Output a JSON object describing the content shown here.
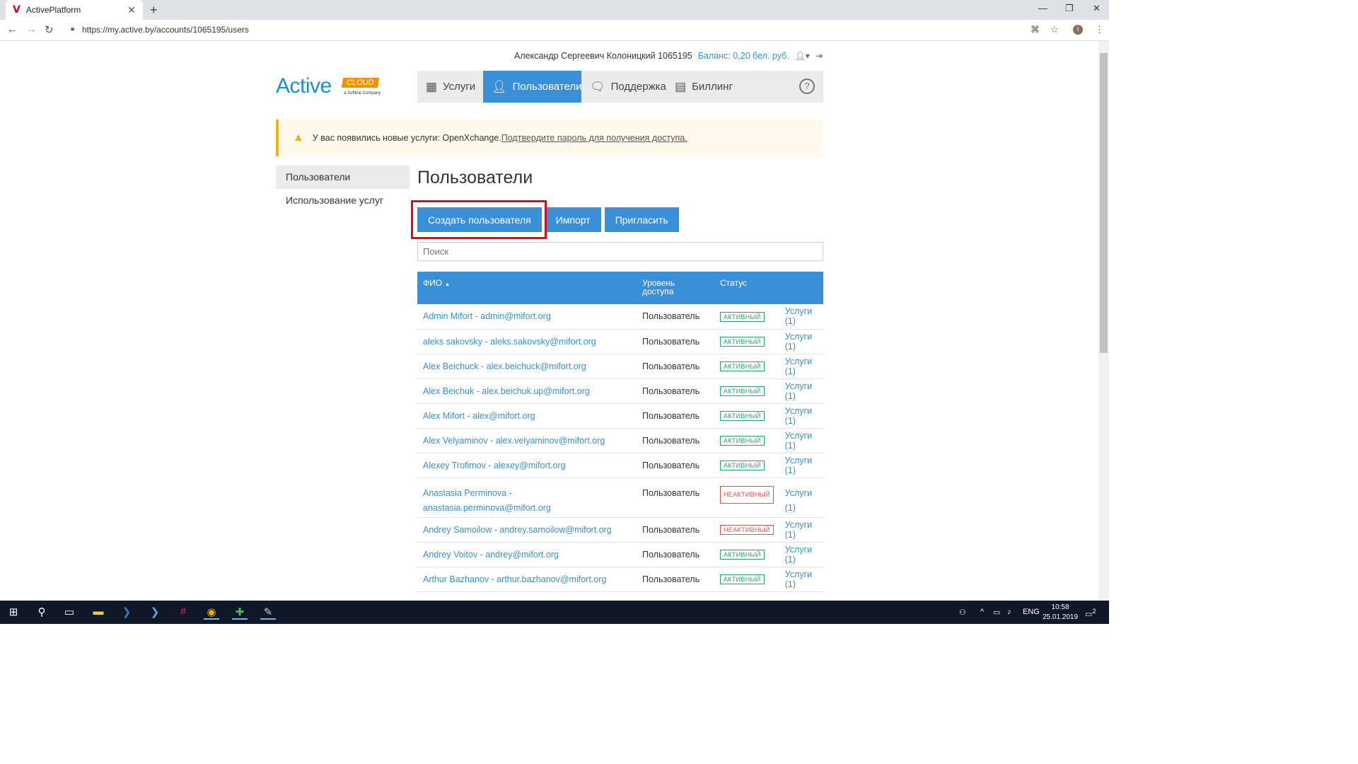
{
  "browser": {
    "tab_title": "ActivePlatform",
    "favicon": "V",
    "url": "https://my.active.by/accounts/1065195/users"
  },
  "header": {
    "user_name": "Александр Сергеевич Колоницкий 1065195",
    "balance": "Баланс: 0,20 бел. руб."
  },
  "logo": {
    "main": "Active",
    "badge": "CLOUD",
    "tagline": "a Softline Company"
  },
  "nav": [
    {
      "label": "Услуги",
      "icon": "building-icon"
    },
    {
      "label": "Пользователи",
      "icon": "user-icon",
      "active": true
    },
    {
      "label": "Поддержка",
      "icon": "chat-icon"
    },
    {
      "label": "Биллинг",
      "icon": "document-icon"
    }
  ],
  "alert": {
    "text": "У вас появились новые услуги: OpenXchange.",
    "link": "Подтвердите пароль для получения доступа."
  },
  "sidebar": [
    {
      "label": "Пользователи",
      "active": true
    },
    {
      "label": "Использование услуг"
    }
  ],
  "main": {
    "title": "Пользователи",
    "buttons": {
      "create": "Создать пользователя",
      "import": "Импорт",
      "invite": "Пригласить"
    },
    "search_placeholder": "Поиск"
  },
  "table": {
    "headers": {
      "name": "ФИО",
      "access": "Уровень доступа",
      "status": "Статус"
    },
    "rows": [
      {
        "name": "Admin Mifort - admin@mifort.org",
        "access": "Пользователь",
        "status": "АКТИВНЫЙ",
        "services": "Услуги (1)"
      },
      {
        "name": "aleks sakovsky - aleks.sakovsky@mifort.org",
        "access": "Пользователь",
        "status": "АКТИВНЫЙ",
        "services": "Услуги (1)"
      },
      {
        "name": "Alex Beichuck - alex.beichuck@mifort.org",
        "access": "Пользователь",
        "status": "АКТИВНЫЙ",
        "services": "Услуги (1)"
      },
      {
        "name": "Alex Beichuk - alex.beichuk.up@mifort.org",
        "access": "Пользователь",
        "status": "АКТИВНЫЙ",
        "services": "Услуги (1)"
      },
      {
        "name": "Alex Mifort - alex@mifort.org",
        "access": "Пользователь",
        "status": "АКТИВНЫЙ",
        "services": "Услуги (1)"
      },
      {
        "name": "Alex Velyaminov - alex.velyaminov@mifort.org",
        "access": "Пользователь",
        "status": "АКТИВНЫЙ",
        "services": "Услуги (1)"
      },
      {
        "name": "Alexey Trofimov - alexey@mifort.org",
        "access": "Пользователь",
        "status": "АКТИВНЫЙ",
        "services": "Услуги (1)"
      },
      {
        "name": "Anastasia Perminova - anastasia.perminova@mifort.org",
        "access": "Пользователь",
        "status": "НЕАКТИВНЫЙ",
        "services": "Услуги (1)"
      },
      {
        "name": "Andrey Samoilow - andrey.samoilow@mifort.org",
        "access": "Пользователь",
        "status": "НЕАКТИВНЫЙ",
        "services": "Услуги (1)"
      },
      {
        "name": "Andrey Voitov - andrey@mifort.org",
        "access": "Пользователь",
        "status": "АКТИВНЫЙ",
        "services": "Услуги (1)"
      },
      {
        "name": "Arthur Bazhanov - arthur.bazhanov@mifort.org",
        "access": "Пользователь",
        "status": "АКТИВНЫЙ",
        "services": "Услуги (1)"
      }
    ]
  },
  "taskbar": {
    "lang": "ENG",
    "time": "10:58",
    "date": "25.01.2019",
    "notifications": "2"
  },
  "colors": {
    "accent": "#3a8fd9",
    "link": "#3a8fc9",
    "active_badge": "#29a36a",
    "inactive_badge": "#d9534f",
    "highlight": "#d0101e"
  }
}
